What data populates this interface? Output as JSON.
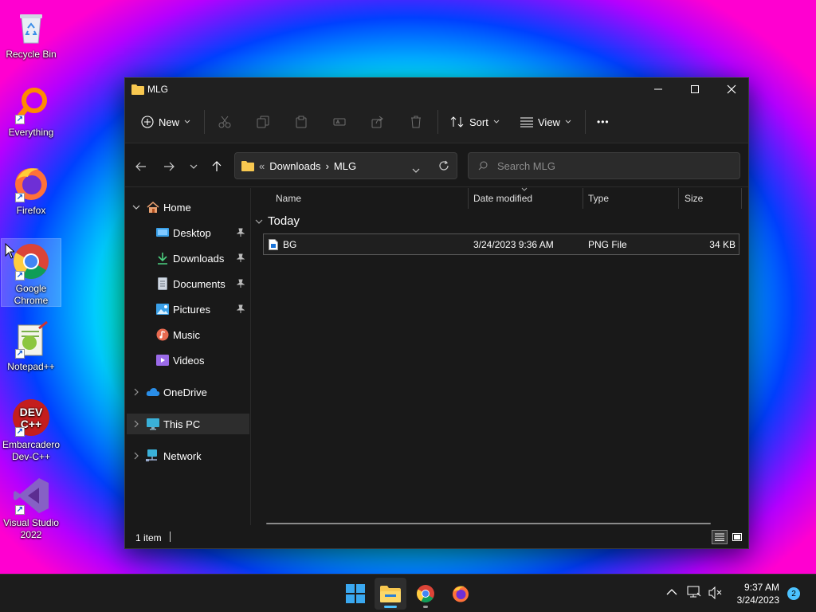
{
  "desktop": {
    "icons": [
      {
        "label": "Recycle Bin"
      },
      {
        "label": "Everything"
      },
      {
        "label": "Firefox"
      },
      {
        "label": "Google Chrome"
      },
      {
        "label": "Notepad++"
      },
      {
        "label": "Embarcadero Dev-C++"
      },
      {
        "label": "Visual Studio 2022"
      }
    ],
    "devcpp_glyph": "DEV\nC++"
  },
  "window": {
    "title": "MLG",
    "toolbar": {
      "new_label": "New",
      "sort_label": "Sort",
      "view_label": "View",
      "more_label": "•••"
    },
    "address": {
      "overflow": "«",
      "crumbs": [
        "Downloads",
        "MLG"
      ],
      "separator": "›"
    },
    "search": {
      "placeholder": "Search MLG"
    },
    "nav": {
      "home": "Home",
      "quick_access": [
        {
          "label": "Desktop",
          "pinned": true
        },
        {
          "label": "Downloads",
          "pinned": true
        },
        {
          "label": "Documents",
          "pinned": true
        },
        {
          "label": "Pictures",
          "pinned": true
        },
        {
          "label": "Music",
          "pinned": false
        },
        {
          "label": "Videos",
          "pinned": false
        }
      ],
      "onedrive": "OneDrive",
      "this_pc": "This PC",
      "network": "Network"
    },
    "columns": {
      "name": "Name",
      "date": "Date modified",
      "type": "Type",
      "size": "Size"
    },
    "group": "Today",
    "files": [
      {
        "name": "BG",
        "date": "3/24/2023 9:36 AM",
        "type": "PNG File",
        "size": "34 KB"
      }
    ],
    "status": {
      "count": "1 item"
    }
  },
  "taskbar": {
    "time": "9:37 AM",
    "date": "3/24/2023",
    "notifications": "2"
  },
  "colors": {
    "accent": "#4cc2ff",
    "folder": "#f8c850",
    "window_bg": "#191919",
    "chrome_bg": "#202020"
  }
}
